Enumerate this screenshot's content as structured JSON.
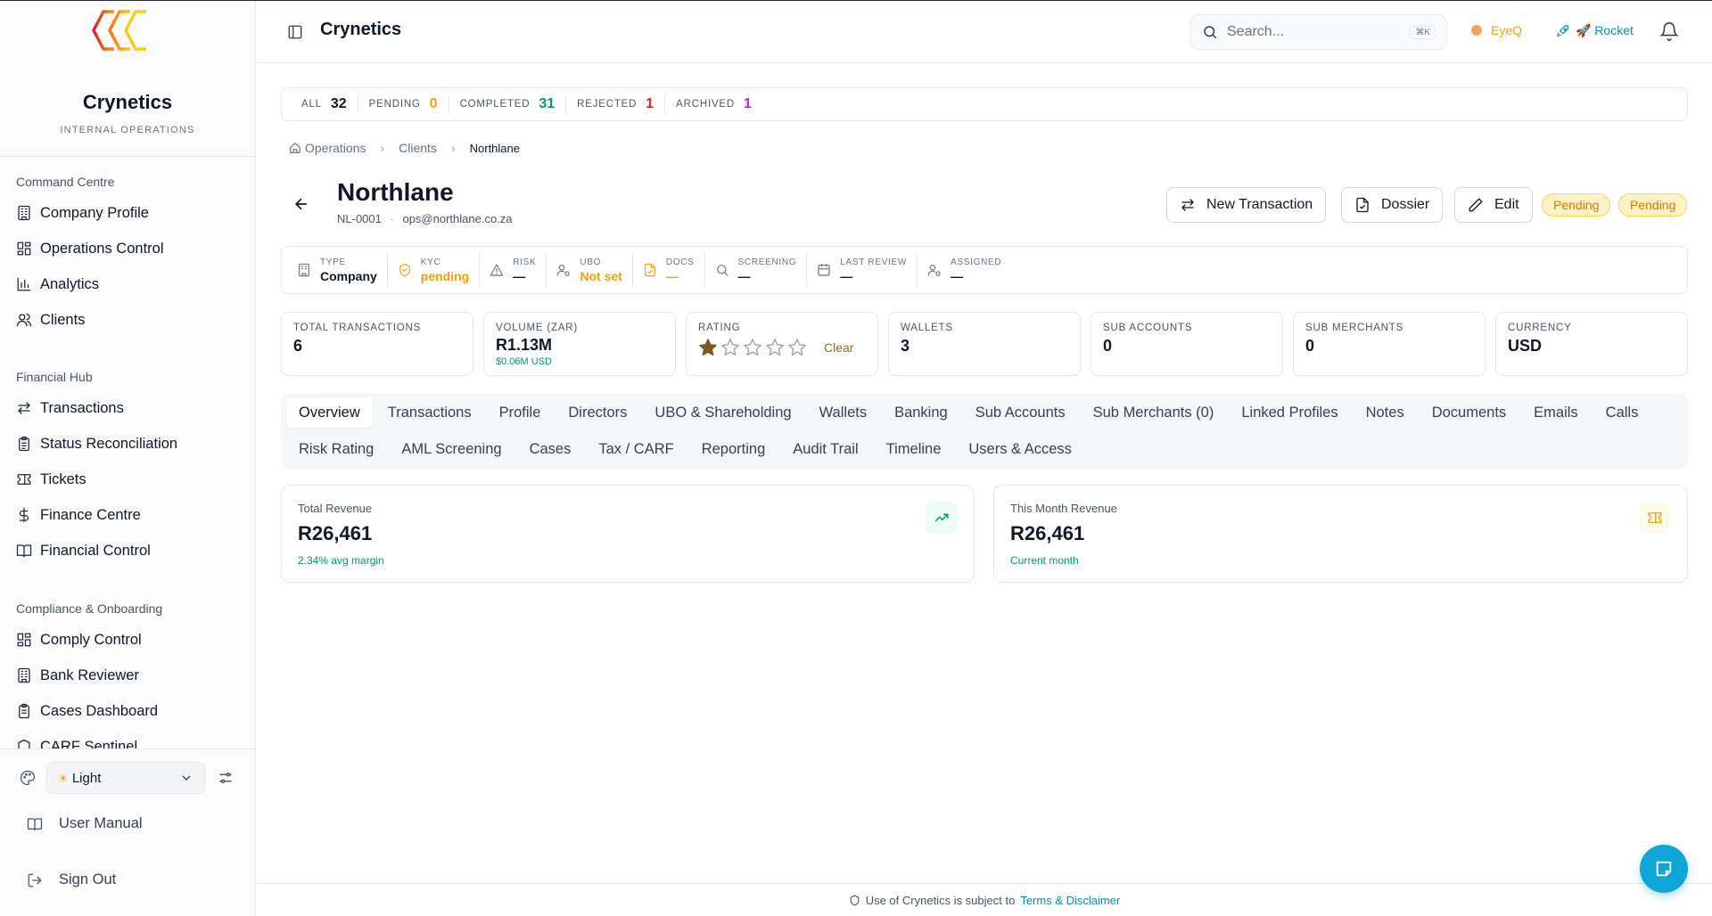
{
  "brand": {
    "name": "Crynetics",
    "subtitle": "INTERNAL OPERATIONS"
  },
  "colors": {
    "accent": "#0ea5d8",
    "warning": "#f59e0b",
    "success": "#059669",
    "danger": "#dc2626",
    "archived": "#c026d3"
  },
  "sidebar": {
    "sections": [
      {
        "title": "Command Centre",
        "items": [
          {
            "label": "Company Profile",
            "icon": "building-icon"
          },
          {
            "label": "Operations Control",
            "icon": "grid-icon"
          },
          {
            "label": "Analytics",
            "icon": "bar-chart-icon"
          },
          {
            "label": "Clients",
            "icon": "users-icon"
          }
        ]
      },
      {
        "title": "Financial Hub",
        "items": [
          {
            "label": "Transactions",
            "icon": "arrows-icon"
          },
          {
            "label": "Status Reconciliation",
            "icon": "clipboard-icon"
          },
          {
            "label": "Tickets",
            "icon": "ticket-icon"
          },
          {
            "label": "Finance Centre",
            "icon": "dollar-icon"
          },
          {
            "label": "Financial Control",
            "icon": "book-icon"
          }
        ]
      },
      {
        "title": "Compliance & Onboarding",
        "items": [
          {
            "label": "Comply Control",
            "icon": "grid-icon"
          },
          {
            "label": "Bank Reviewer",
            "icon": "building-icon"
          },
          {
            "label": "Cases Dashboard",
            "icon": "clipboard-icon"
          },
          {
            "label": "CARF Sentinel",
            "icon": "shield-icon"
          }
        ]
      }
    ],
    "theme": {
      "value": "Light"
    },
    "user_manual": "User Manual",
    "sign_out": "Sign Out"
  },
  "topbar": {
    "title": "Crynetics",
    "search_placeholder": "Search...",
    "search_kbd": "⌘K",
    "eyeq": "EyeQ",
    "rocket": "🚀 Rocket"
  },
  "status_counts": [
    {
      "label": "ALL",
      "value": "32",
      "color": "#111827"
    },
    {
      "label": "PENDING",
      "value": "0",
      "color": "#f59e0b"
    },
    {
      "label": "COMPLETED",
      "value": "31",
      "color": "#059669"
    },
    {
      "label": "REJECTED",
      "value": "1",
      "color": "#dc2626"
    },
    {
      "label": "ARCHIVED",
      "value": "1",
      "color": "#c026d3"
    }
  ],
  "breadcrumb": {
    "home": "Operations",
    "parent": "Clients",
    "current": "Northlane"
  },
  "client": {
    "name": "Northlane",
    "id": "NL-0001",
    "dot": "·",
    "email": "ops@northlane.co.za"
  },
  "actions": {
    "new_transaction": "New Transaction",
    "dossier": "Dossier",
    "edit": "Edit",
    "badge1": "Pending",
    "badge2": "Pending"
  },
  "info": [
    {
      "label": "TYPE",
      "value": "Company",
      "warn": false
    },
    {
      "label": "KYC",
      "value": "pending",
      "warn": true
    },
    {
      "label": "RISK",
      "value": "—",
      "warn": false
    },
    {
      "label": "UBO",
      "value": "Not set",
      "warn": true
    },
    {
      "label": "DOCS",
      "value": "—",
      "warn": true
    },
    {
      "label": "SCREENING",
      "value": "—",
      "warn": false
    },
    {
      "label": "LAST REVIEW",
      "value": "—",
      "warn": false
    },
    {
      "label": "ASSIGNED",
      "value": "—",
      "warn": false
    }
  ],
  "metrics": {
    "total_transactions": {
      "label": "TOTAL TRANSACTIONS",
      "value": "6"
    },
    "volume": {
      "label": "VOLUME (ZAR)",
      "value": "R1.13M",
      "sub": "$0.06M USD"
    },
    "rating": {
      "label": "RATING",
      "stars": 1,
      "max": 5,
      "clear": "Clear"
    },
    "wallets": {
      "label": "WALLETS",
      "value": "3"
    },
    "sub_accounts": {
      "label": "SUB ACCOUNTS",
      "value": "0"
    },
    "sub_merchants": {
      "label": "SUB MERCHANTS",
      "value": "0"
    },
    "currency": {
      "label": "CURRENCY",
      "value": "USD"
    }
  },
  "tabs_row1": [
    "Overview",
    "Transactions",
    "Profile",
    "Directors",
    "UBO & Shareholding",
    "Wallets",
    "Banking",
    "Sub Accounts",
    "Sub Merchants (0)",
    "Linked Profiles",
    "Notes",
    "Documents",
    "Emails",
    "Calls"
  ],
  "tabs_row2": [
    "Risk Rating",
    "AML Screening",
    "Cases",
    "Tax / CARF",
    "Reporting",
    "Audit Trail",
    "Timeline",
    "Users & Access"
  ],
  "revenue": {
    "total": {
      "label": "Total Revenue",
      "value": "R26,461",
      "sub": "2.34% avg margin"
    },
    "month": {
      "label": "This Month Revenue",
      "value": "R26,461",
      "sub": "Current month"
    }
  },
  "footer": {
    "text": "Use of Crynetics is subject to",
    "link": "Terms & Disclaimer"
  }
}
